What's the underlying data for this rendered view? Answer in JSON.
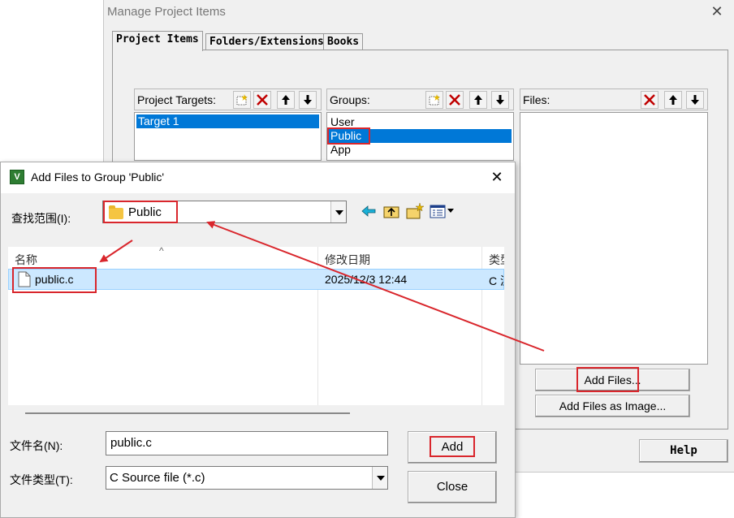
{
  "manage_window": {
    "title": "Manage Project Items",
    "close_glyph": "✕",
    "tabs": [
      {
        "label": "Project Items",
        "active": true
      },
      {
        "label": "Folders/Extensions",
        "active": false
      },
      {
        "label": "Books",
        "active": false
      }
    ],
    "targets": {
      "label": "Project Targets:",
      "items": [
        {
          "label": "Target 1",
          "selected": true
        }
      ]
    },
    "groups": {
      "label": "Groups:",
      "items": [
        {
          "label": "User",
          "selected": false
        },
        {
          "label": "Public",
          "selected": true
        },
        {
          "label": "App",
          "selected": false
        }
      ]
    },
    "files": {
      "label": "Files:",
      "items": []
    },
    "add_files_label": "Add Files...",
    "add_files_image_label": "Add Files as Image...",
    "help_label": "Help"
  },
  "add_dialog": {
    "title": "Add Files to Group 'Public'",
    "close_glyph": "✕",
    "icon_letter": "V",
    "look_in_label": "查找范围(I):",
    "look_in_value": "Public",
    "columns": {
      "name": "名称",
      "date": "修改日期",
      "type": "类型"
    },
    "files": [
      {
        "name": "public.c",
        "date": "2025/12/3 12:44",
        "type": "C 源文件",
        "selected": true
      }
    ],
    "filename_label": "文件名(N):",
    "filename_value": "public.c",
    "filetype_label": "文件类型(T):",
    "filetype_value": "C Source file (*.c)",
    "add_label": "Add",
    "close_label": "Close"
  },
  "colors": {
    "annotation_red": "#d9262c",
    "selection_blue": "#0078d7",
    "file_row_selection": "#cce8ff"
  },
  "icons": [
    "new-item-icon",
    "delete-icon",
    "move-up-icon",
    "move-down-icon",
    "back-arrow-icon",
    "up-folder-icon",
    "new-folder-icon",
    "view-menu-icon",
    "folder-icon",
    "file-icon",
    "app-icon"
  ]
}
